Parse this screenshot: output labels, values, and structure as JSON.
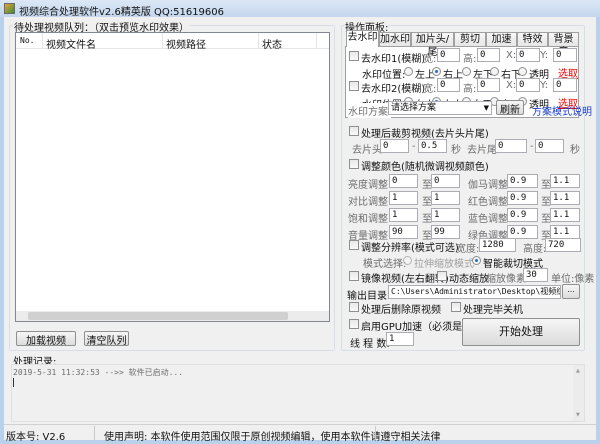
{
  "title": "视频综合处理软件v2.6精英版  QQ:51619606",
  "queue": {
    "label": "待处理视频队列：（双击预览水印效果）",
    "columns": [
      "No.",
      "视频文件名",
      "视频路径",
      "状态"
    ],
    "load_button": "加载视频",
    "clear_button": "清空队列"
  },
  "panel": {
    "label": "操作面板:",
    "tabs": [
      "去水印",
      "加水印",
      "加片头/尾",
      "剪切",
      "加速",
      "特效",
      "背景音"
    ],
    "active_tab": 0
  },
  "watermark": {
    "wm1_label": "去水印1(模糊)",
    "wm2_label": "去水印2(模糊)",
    "width_label": "宽:",
    "height_label": "高:",
    "x_label": "X:",
    "y_label": "Y:",
    "wm1": {
      "w": "0",
      "h": "0",
      "x": "0",
      "y": "0"
    },
    "wm2": {
      "w": "0",
      "h": "0",
      "x": "0",
      "y": "0"
    },
    "position_label": "水印位置:",
    "positions": [
      "左上",
      "右上",
      "左下",
      "右下",
      "透明"
    ],
    "selected_position": "右上",
    "pick_link": "选取",
    "scheme_label": "水印方案:",
    "scheme_value": "请选择方案",
    "refresh_button": "刷新",
    "help_link": "方案模式说明"
  },
  "trim": {
    "label": "处理后裁剪视频(去片头片尾)",
    "head_label": "去片头:",
    "head_from": "0",
    "head_to": "0.5",
    "tail_label": "去片尾:",
    "tail_from": "0",
    "tail_to": "0",
    "sep": "-",
    "unit": "秒"
  },
  "color": {
    "label": "调整颜色(随机微调视频颜色)",
    "to": "至",
    "rows": [
      {
        "l": "亮度调整:",
        "a": "0",
        "b": "0",
        "rl": "伽马调整:",
        "ra": "0.9",
        "rb": "1.1"
      },
      {
        "l": "对比调整:",
        "a": "1",
        "b": "1",
        "rl": "红色调整:",
        "ra": "0.9",
        "rb": "1.1"
      },
      {
        "l": "饱和调整:",
        "a": "1",
        "b": "1",
        "rl": "蓝色调整:",
        "ra": "0.9",
        "rb": "1.1"
      },
      {
        "l": "音量调整:",
        "a": "90",
        "b": "99",
        "rl": "绿色调整:",
        "ra": "0.9",
        "rb": "1.1"
      }
    ]
  },
  "resolution": {
    "label": "调整分辨率(模式可选)",
    "width_label": "宽度:",
    "width": "1280",
    "height_label": "高度:",
    "height": "720",
    "mode_label": "模式选择:",
    "modes": [
      "拉伸缩放模式",
      "智能裁切模式"
    ],
    "selected_mode": "智能裁切模式"
  },
  "mirror": {
    "label": "镜像视频(左右翻转)",
    "zoom_label": "动态缩放",
    "pixels_label": "缩放像素:",
    "pixels": "30",
    "unit": "单位:像素"
  },
  "output": {
    "label": "输出目录:",
    "path": "C:\\Users\\Administrator\\Desktop\\视频综合处理软件",
    "browse": "..."
  },
  "options": {
    "delete_source": "处理后删除原视频",
    "shutdown": "处理完毕关机",
    "gpu": "启用GPU加速（必须是N卡）",
    "threads_label": "线 程 数:",
    "threads": "1",
    "start_button": "开始处理"
  },
  "log": {
    "label": "处理记录:",
    "lines": [
      "2019-5-31 11:32:53 -->> 软件已启动..."
    ]
  },
  "status": {
    "version": "版本号: V2.6",
    "notice": "使用声明: 本软件使用范围仅限于原创视频编辑，使用本软件请遵守相关法律"
  }
}
